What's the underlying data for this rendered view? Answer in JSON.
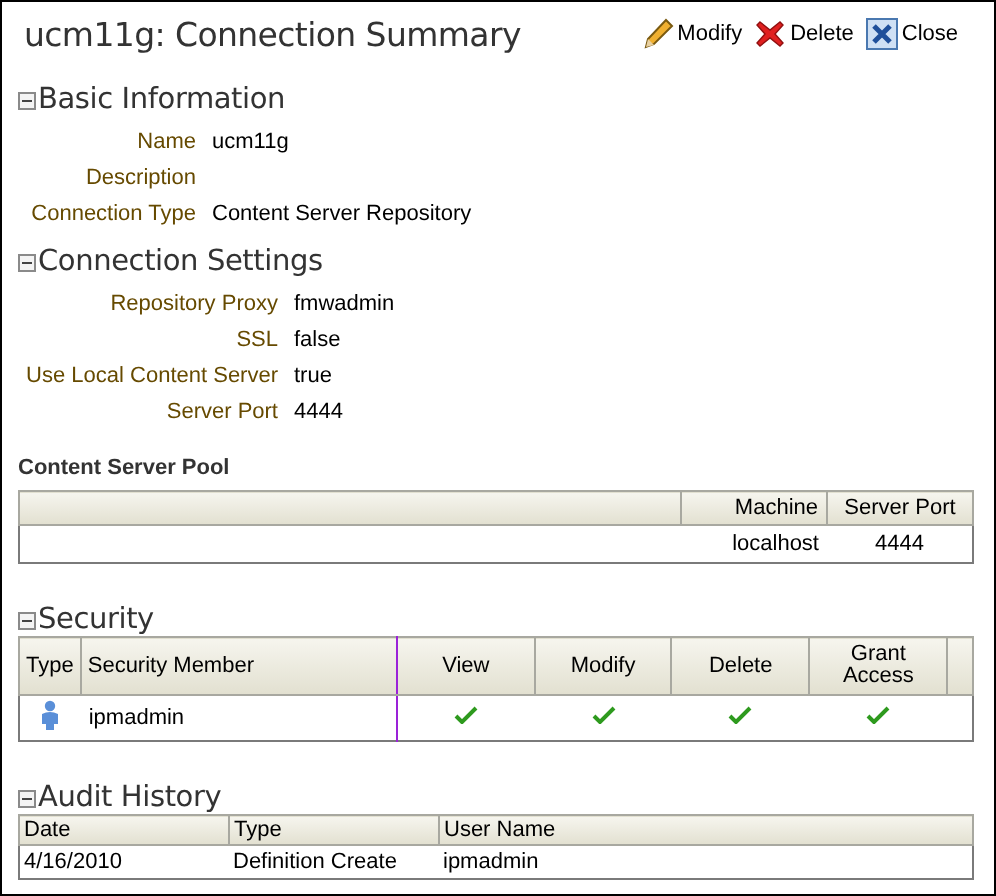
{
  "page": {
    "title": "ucm11g: Connection Summary"
  },
  "actions": [
    {
      "kind": "modify",
      "label": "Modify"
    },
    {
      "kind": "delete",
      "label": "Delete"
    },
    {
      "kind": "close",
      "label": "Close"
    }
  ],
  "basic_information": {
    "title": "Basic Information",
    "expanded": true,
    "fields": [
      {
        "label": "Name",
        "value": "ucm11g"
      },
      {
        "label": "Description"
      },
      {
        "label": "Connection Type",
        "value": "Content Server Repository"
      }
    ]
  },
  "connection_settings": {
    "title": "Connection Settings",
    "expanded": true,
    "fields": [
      {
        "label": "Repository Proxy",
        "value": "fmwadmin"
      },
      {
        "label": "SSL",
        "value": "false"
      },
      {
        "label": "Use Local Content Server",
        "value": "true"
      },
      {
        "label": "Server Port",
        "value": "4444"
      }
    ]
  },
  "content_server_pool": {
    "title": "Content Server Pool",
    "columns": [
      "Machine",
      "Server Port"
    ],
    "rows": [
      {
        "machine": "localhost",
        "server_port": "4444"
      }
    ]
  },
  "security": {
    "title": "Security",
    "expanded": true,
    "columns": [
      "Type",
      "Security Member",
      "View",
      "Modify",
      "Delete",
      "Grant Access"
    ],
    "rows": [
      {
        "kind": "user",
        "member": "ipmadmin",
        "permissions": [
          {
            "checked": true
          },
          {
            "checked": true
          },
          {
            "checked": true
          },
          {
            "checked": true
          }
        ]
      }
    ]
  },
  "audit_history": {
    "title": "Audit History",
    "expanded": true,
    "columns": [
      "Date",
      "Type",
      "User Name"
    ],
    "rows": [
      [
        "4/16/2010",
        "Definition Create",
        "ipmadmin"
      ]
    ]
  }
}
